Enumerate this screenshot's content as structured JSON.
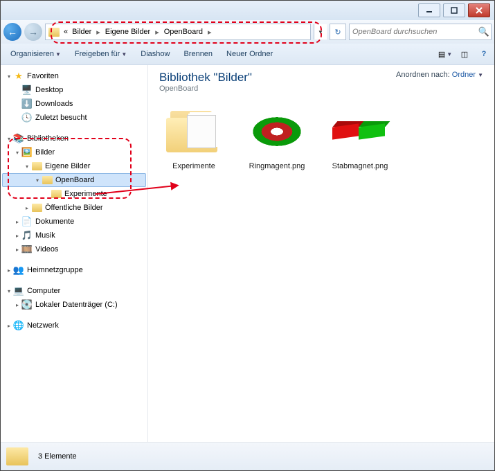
{
  "breadcrumb": {
    "prefix": "«",
    "items": [
      "Bilder",
      "Eigene Bilder",
      "OpenBoard"
    ]
  },
  "search": {
    "placeholder": "OpenBoard durchsuchen"
  },
  "toolbar": {
    "organize": "Organisieren",
    "share": "Freigeben für",
    "slideshow": "Diashow",
    "burn": "Brennen",
    "newfolder": "Neuer Ordner"
  },
  "tree": {
    "fav": "Favoriten",
    "desktop": "Desktop",
    "downloads": "Downloads",
    "recent": "Zuletzt besucht",
    "libs": "Bibliotheken",
    "pics": "Bilder",
    "ownpics": "Eigene Bilder",
    "openboard": "OpenBoard",
    "exp": "Experimente",
    "pubpics": "Öffentliche Bilder",
    "docs": "Dokumente",
    "music": "Musik",
    "videos": "Videos",
    "homegroup": "Heimnetzgruppe",
    "computer": "Computer",
    "drive": "Lokaler Datenträger (C:)",
    "network": "Netzwerk"
  },
  "library": {
    "title": "Bibliothek \"Bilder\"",
    "sub": "OpenBoard",
    "sort_label": "Anordnen nach:",
    "sort_value": "Ordner"
  },
  "items": {
    "i0": "Experimente",
    "i1": "Ringmagent.png",
    "i2": "Stabmagnet.png"
  },
  "status": {
    "text": "3 Elemente"
  }
}
